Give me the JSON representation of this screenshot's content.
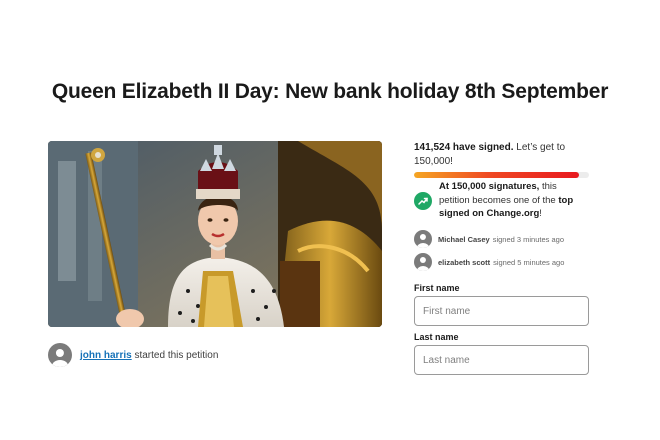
{
  "petition": {
    "title": "Queen Elizabeth II Day: New bank holiday 8th September",
    "starter": {
      "name": "john harris",
      "action": "started this petition"
    }
  },
  "signatures": {
    "count_bold": "141,524 have signed.",
    "goal_text": "Let’s get to 150,000!",
    "progress_fraction": 0.943,
    "milestone_prefix": "At 150,000 signatures,",
    "milestone_middle": "this petition becomes one of the",
    "milestone_top": "top signed on Change.org",
    "milestone_end": "!"
  },
  "recent_signers": [
    {
      "name": "Michael Casey",
      "action": "signed 3 minutes ago"
    },
    {
      "name": "elizabeth scott",
      "action": "signed 5 minutes ago"
    }
  ],
  "form": {
    "first_name_label": "First name",
    "first_name_placeholder": "First name",
    "last_name_label": "Last name",
    "last_name_placeholder": "Last name"
  },
  "colors": {
    "link": "#1672b8",
    "progress_start": "#f5a623",
    "progress_end": "#e8191f",
    "trend_icon": "#1fa865"
  },
  "icons": {
    "avatar": "user-avatar-icon",
    "milestone": "trending-up-icon"
  }
}
